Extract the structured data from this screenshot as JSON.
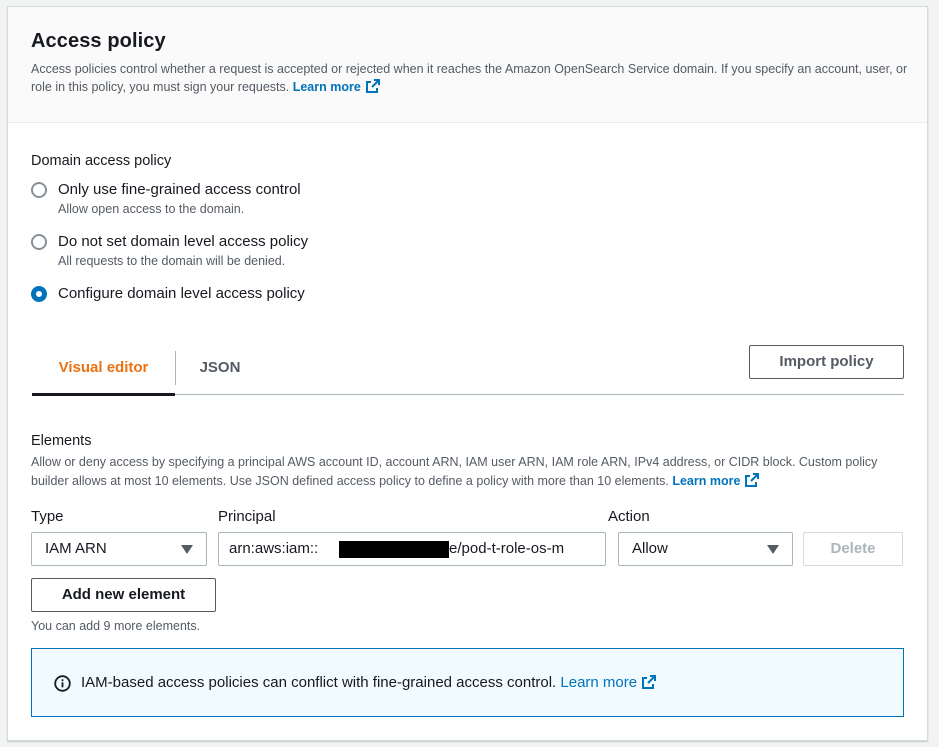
{
  "header": {
    "title": "Access policy",
    "description": "Access policies control whether a request is accepted or rejected when it reaches the Amazon OpenSearch Service domain. If you specify an account, user, or role in this policy, you must sign your requests.",
    "learn_more": "Learn more"
  },
  "domain_access_policy": {
    "label": "Domain access policy",
    "options": [
      {
        "label": "Only use fine-grained access control",
        "description": "Allow open access to the domain.",
        "selected": false
      },
      {
        "label": "Do not set domain level access policy",
        "description": "All requests to the domain will be denied.",
        "selected": false
      },
      {
        "label": "Configure domain level access policy",
        "description": "",
        "selected": true
      }
    ]
  },
  "tabs": [
    {
      "label": "Visual editor",
      "active": true
    },
    {
      "label": "JSON",
      "active": false
    }
  ],
  "import_button": "Import policy",
  "elements": {
    "title": "Elements",
    "description": "Allow or deny access by specifying a principal AWS account ID, account ARN, IAM user ARN, IAM role ARN, IPv4 address, or CIDR block. Custom policy builder allows at most 10 elements. Use JSON defined access policy to define a policy with more than 10 elements.",
    "learn_more": "Learn more",
    "columns": {
      "type": "Type",
      "principal": "Principal",
      "action": "Action"
    },
    "row": {
      "type": "IAM ARN",
      "principal_prefix": "arn:aws:iam::",
      "principal_suffix": ":role/pod-t-role-os-m",
      "action": "Allow",
      "delete": "Delete"
    },
    "add_button": "Add new element",
    "remaining_hint": "You can add 9 more elements."
  },
  "info_alert": {
    "text": "IAM-based access policies can conflict with fine-grained access control.",
    "link": "Learn more"
  },
  "colors": {
    "accent": "#0073bb",
    "active_tab": "#ec7211",
    "info_bg": "#f1faff"
  }
}
